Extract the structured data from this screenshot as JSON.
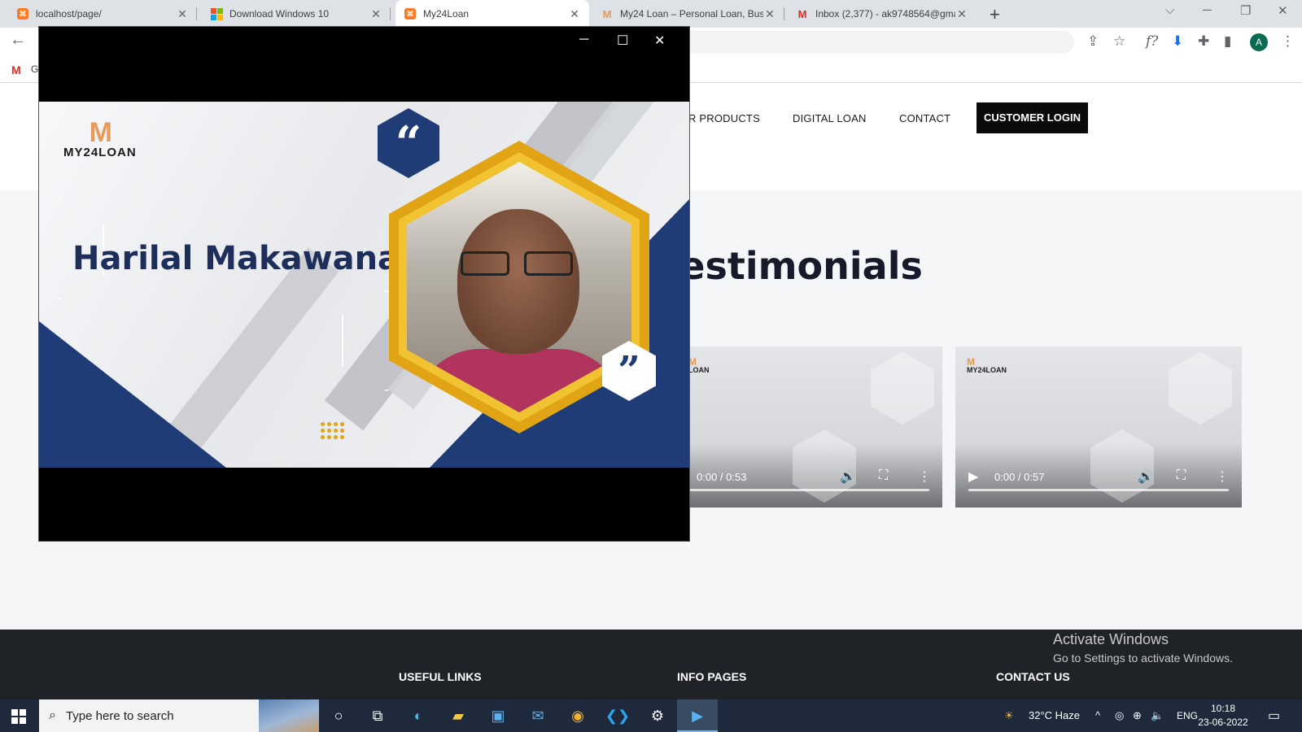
{
  "browser": {
    "tabs": [
      {
        "title": "localhost/page/",
        "icon": "xampp-icon"
      },
      {
        "title": "Download Windows 10",
        "icon": "windows-icon"
      },
      {
        "title": "My24Loan",
        "icon": "xampp-icon",
        "active": true
      },
      {
        "title": "My24 Loan – Personal Loan, Busi",
        "icon": "my24loan-icon"
      },
      {
        "title": "Inbox (2,377) - ak9748564@gma",
        "icon": "gmail-icon"
      }
    ],
    "profile_initial": "A",
    "bookmark_letter": "G"
  },
  "site": {
    "nav": {
      "products": "R PRODUCTS",
      "digital_loan": "DIGITAL LOAN",
      "contact": "CONTACT",
      "login": "CUSTOMER LOGIN"
    },
    "section_title": "Testimonials",
    "videos": [
      {
        "brand": "LOAN",
        "time": "0:00 / 0:53"
      },
      {
        "brand": "MY24LOAN",
        "time": "0:00 / 0:57"
      }
    ],
    "footer": {
      "useful_links": "USEFUL LINKS",
      "info_pages": "INFO PAGES",
      "contact_us": "CONTACT US"
    }
  },
  "player": {
    "logo_text": "MY24LOAN",
    "person_name": "Harilal Makawana",
    "open_quote": "“",
    "close_quote": "”"
  },
  "watermark": {
    "line1": "Activate Windows",
    "line2": "Go to Settings to activate Windows."
  },
  "taskbar": {
    "search_placeholder": "Type here to search",
    "weather": "32°C  Haze",
    "language": "ENG",
    "time": "10:18",
    "date": "23-06-2022"
  },
  "colors": {
    "brand_navy": "#1f3c77",
    "brand_orange": "#e89a5a",
    "accent_gold": "#e0a415"
  }
}
